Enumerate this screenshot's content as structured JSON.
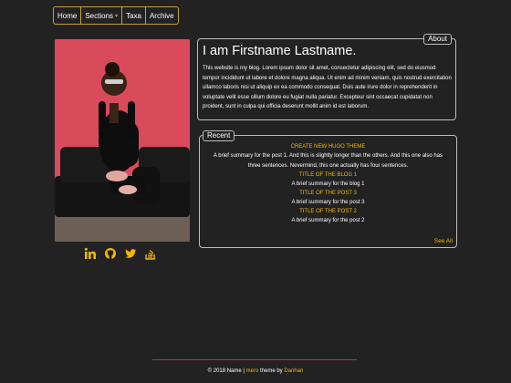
{
  "nav": {
    "items": [
      {
        "label": "Home"
      },
      {
        "label": "Sections"
      },
      {
        "label": "Taxa"
      },
      {
        "label": "Archive"
      }
    ]
  },
  "about": {
    "legend": "About",
    "title": "I am Firstname Lastname.",
    "text": "This website is my blog. Lorem ipsum dolor sit amet, consectetur adipiscing elit, sed do eiusmod tempor incididunt ut labore et dolore magna aliqua. Ut enim ad minim veniam, quis nostrud exercitation ullamco laboris nisi ut aliquip ex ea commodo consequat. Duis aute irure dolor in reprehenderit in voluptate velit esse cillum dolore eu fugiat nulla pariatur. Excepteur sint occaecat cupidatat non proident, sunt in culpa qui officia deserunt mollit anim id est laborum."
  },
  "recent": {
    "legend": "Recent",
    "posts": [
      {
        "title": "CREATE NEW HUGO THEME",
        "summary": "A brief summary for the post 1. And this is slightly longer than the others. And this one also has three sentences. Nevermind, this one actually has four sentences."
      },
      {
        "title": "TITLE OF THE BLOG 1",
        "summary": "A brief summary for the blog 1"
      },
      {
        "title": "TITLE OF THE POST 3",
        "summary": "A brief summary for the post 3"
      },
      {
        "title": "TITLE OF THE POST 2",
        "summary": "A brief summary for the post 2"
      }
    ],
    "see_all": "See All"
  },
  "social": [
    "linkedin-icon",
    "github-icon",
    "twitter-icon",
    "stackoverflow-icon"
  ],
  "colors": {
    "accent": "#f2b705",
    "rule": "#d21f3c",
    "background": "#222222"
  },
  "footer": {
    "prefix": "© 2018 Name |",
    "theme": "mero",
    "middle": "theme by",
    "author": "Danhan"
  }
}
